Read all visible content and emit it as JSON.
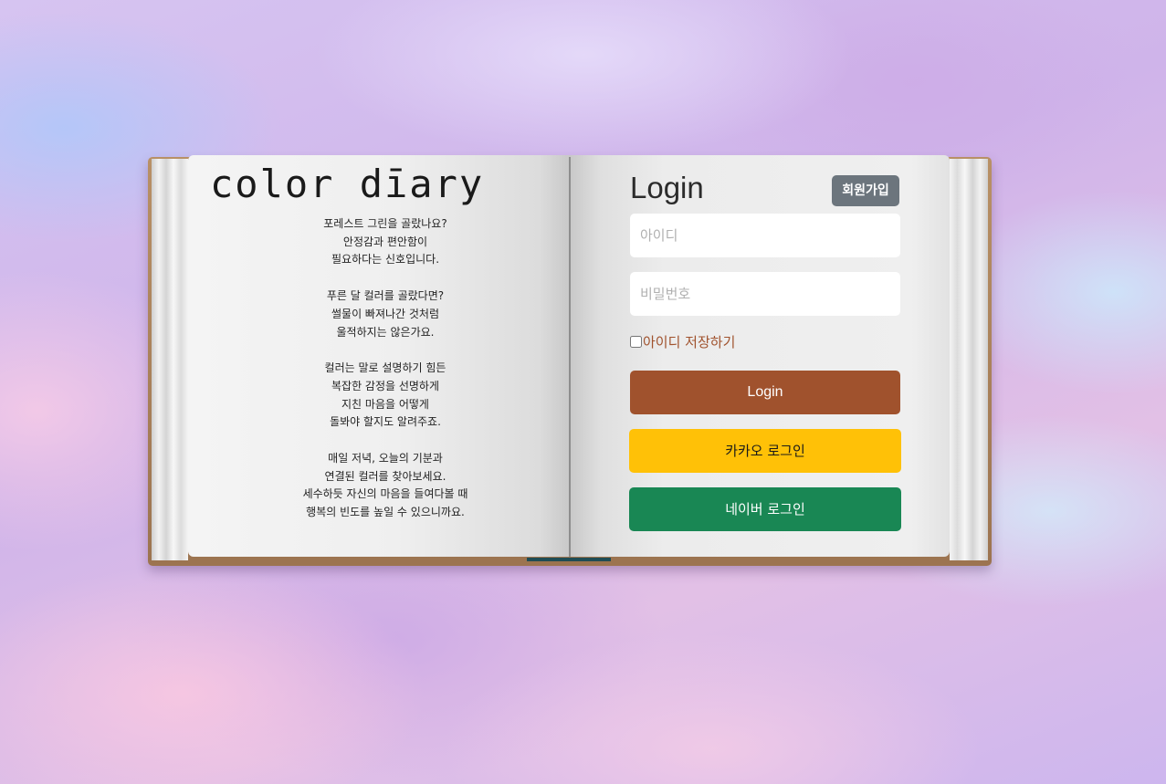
{
  "diary": {
    "title": "color dīary",
    "poem": [
      [
        "포레스트 그린을 골랐나요?",
        "안정감과 편안함이",
        "필요하다는 신호입니다."
      ],
      [
        "푸른 달 컬러를 골랐다면?",
        "썰물이 빠져나간 것처럼",
        "울적하지는 않은가요."
      ],
      [
        "컬러는 말로 설명하기 힘든",
        "복잡한 감정을 선명하게",
        "지친 마음을 어떻게",
        "돌봐야 할지도 알려주죠."
      ],
      [
        "매일 저녁, 오늘의 기분과",
        "연결된 컬러를 찾아보세요.",
        "세수하듯 자신의 마음을 들여다볼 때",
        "행복의 빈도를 높일 수 있으니까요."
      ]
    ]
  },
  "login": {
    "title": "Login",
    "signup_label": "회원가입",
    "id_placeholder": "아이디",
    "id_value": "",
    "pw_placeholder": "비밀번호",
    "pw_value": "",
    "remember_label": "아이디 저장하기",
    "remember_checked": false,
    "login_button": "Login",
    "kakao_button": "카카오 로그인",
    "naver_button": "네이버 로그인"
  },
  "colors": {
    "login": "#a0522d",
    "kakao": "#ffc107",
    "naver": "#198754",
    "signup": "#6c757d"
  }
}
